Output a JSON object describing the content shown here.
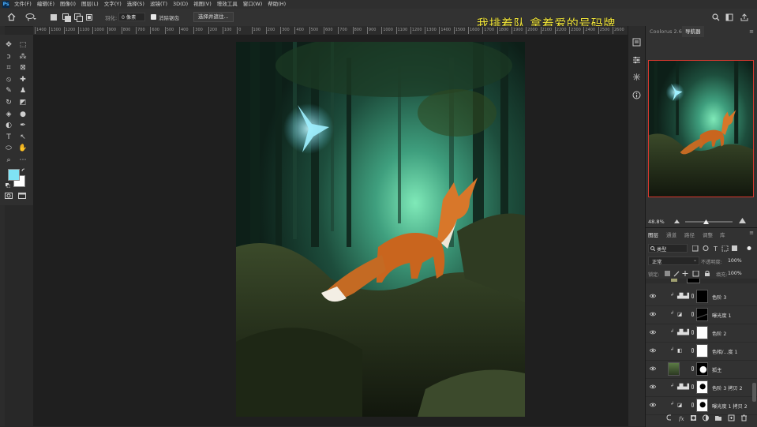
{
  "menu": {
    "logo": "Ps",
    "items": [
      "文件(F)",
      "编辑(E)",
      "图像(I)",
      "图层(L)",
      "文字(Y)",
      "选择(S)",
      "滤镜(T)",
      "3D(D)",
      "视图(V)",
      "增效工具",
      "窗口(W)",
      "帮助(H)"
    ]
  },
  "options": {
    "feather_label": "羽化:",
    "feather_value": "0 像素",
    "antialias_label": "消除锯齿",
    "select_subject_label": "选择并遮住..."
  },
  "overlay_caption": "我排着队 拿着爱的号码牌",
  "ruler": {
    "ticks": [
      "1400",
      "1300",
      "1200",
      "1100",
      "1000",
      "900",
      "800",
      "700",
      "600",
      "500",
      "400",
      "300",
      "200",
      "100",
      "0",
      "100",
      "200",
      "300",
      "400",
      "500",
      "600",
      "700",
      "800",
      "900",
      "1000",
      "1100",
      "1200",
      "1300",
      "1400",
      "1500",
      "1600",
      "1700",
      "1800",
      "1900",
      "2000",
      "2100",
      "2200",
      "2300",
      "2400",
      "2500",
      "2600"
    ]
  },
  "colors": {
    "foreground": "#7fe3f5",
    "background": "#ffffff",
    "accent_red": "#d9382f",
    "overlay_yellow": "#f2e63a"
  },
  "navigator": {
    "tabs": [
      "Coolorus 2.6",
      "导航器"
    ],
    "zoom": "48.8%"
  },
  "layers_panel": {
    "tabs": [
      "图层",
      "通道",
      "路径",
      "调整",
      "库"
    ],
    "filter_label": "类型",
    "blend_mode": "正常",
    "opacity_label": "不透明度:",
    "opacity_value": "100%",
    "lock_label": "锁定:",
    "fill_label": "填充:",
    "fill_value": "100%",
    "layers": [
      {
        "name": "色阶 3",
        "kind": "levels",
        "mask": "dark",
        "clipped": true
      },
      {
        "name": "曝光度 1",
        "kind": "exposure",
        "mask": "dark-curve",
        "clipped": true
      },
      {
        "name": "色阶 2",
        "kind": "levels",
        "mask": "white",
        "clipped": true
      },
      {
        "name": "色相/...度 1",
        "kind": "huesat",
        "mask": "white",
        "clipped": true
      },
      {
        "name": "狐主",
        "kind": "pixel",
        "mask": "fox",
        "clipped": false
      },
      {
        "name": "色阶 3 拷贝 2",
        "kind": "levels",
        "mask": "fox-white",
        "clipped": true
      },
      {
        "name": "曝光度 1 拷贝 2",
        "kind": "exposure",
        "mask": "fox-white",
        "clipped": true
      }
    ]
  },
  "icons": {
    "toolbar": [
      "move-icon",
      "marquee-icon",
      "lasso-icon",
      "magic-wand-icon",
      "crop-icon",
      "frame-icon",
      "eyedropper-icon",
      "healing-icon",
      "brush-icon",
      "stamp-icon",
      "history-brush-icon",
      "eraser-icon",
      "bucket-icon",
      "blur-icon",
      "dodge-icon",
      "pen-icon",
      "type-icon",
      "path-select-icon",
      "shape-icon",
      "hand-icon",
      "zoom-icon",
      "more-icon"
    ]
  }
}
